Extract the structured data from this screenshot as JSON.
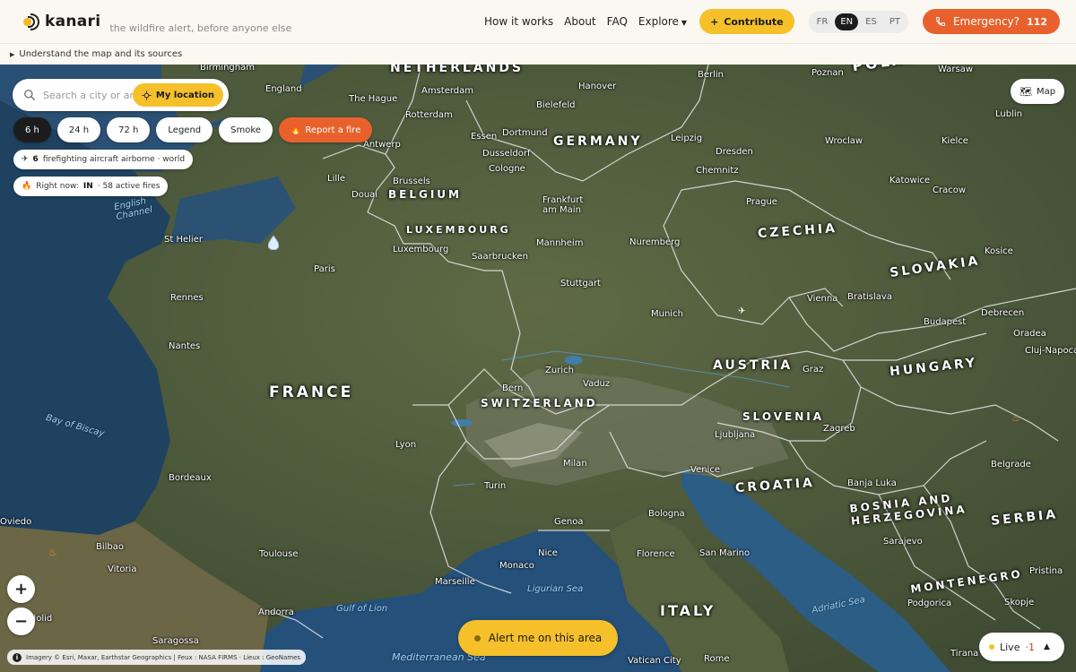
{
  "header": {
    "brand": "kanari",
    "tagline": "the wildfire alert, before anyone else",
    "nav": [
      "How it works",
      "About",
      "FAQ",
      "Explore"
    ],
    "contribute": "Contribute",
    "languages": [
      "FR",
      "EN",
      "ES",
      "PT"
    ],
    "active_language": "EN",
    "emergency_label": "Emergency?",
    "emergency_number": "112"
  },
  "subbar": {
    "label": "Understand the map and its sources"
  },
  "search": {
    "placeholder": "Search a city or area",
    "my_location": "My location"
  },
  "time_filters": [
    "6 h",
    "24 h",
    "72 h"
  ],
  "active_filter": "6 h",
  "buttons": {
    "legend": "Legend",
    "smoke": "Smoke",
    "report": "Report a fire",
    "map": "Map"
  },
  "aircraft": {
    "count": "6",
    "text": "firefighting aircraft airborne · world"
  },
  "right_now": {
    "label": "Right now:",
    "region": "IN",
    "fires": "· 58 active fires"
  },
  "zoom": {
    "in": "+",
    "out": "−"
  },
  "alert_button": "Alert me on this area",
  "attribution": "Imagery © Esri, Maxar, Earthstar Geographics | Feux : NASA FIRMS · Lieux : GeoNames",
  "live": {
    "label": "Live",
    "count": "·1"
  },
  "icons": [
    "search-icon",
    "crosshair-icon",
    "flame-icon",
    "plane-icon",
    "phone-icon",
    "plus-icon",
    "map-icon",
    "info-icon",
    "chevron-up-icon"
  ],
  "colors": {
    "accent": "#f5c02a",
    "emergency": "#e8612d",
    "dark": "#1c1c1c"
  },
  "map": {
    "countries": [
      {
        "id": "netherlands",
        "label": "NETHERLANDS"
      },
      {
        "id": "germany",
        "label": "GERMANY"
      },
      {
        "id": "belgium",
        "label": "BELGIUM"
      },
      {
        "id": "luxembourg",
        "label": "LUXEMBOURG"
      },
      {
        "id": "czechia",
        "label": "CZECHIA"
      },
      {
        "id": "slovakia",
        "label": "SLOVAKIA"
      },
      {
        "id": "austria",
        "label": "AUSTRIA"
      },
      {
        "id": "hungary",
        "label": "HUNGARY"
      },
      {
        "id": "france",
        "label": "FRANCE"
      },
      {
        "id": "switzerland",
        "label": "SWITZERLAND"
      },
      {
        "id": "slovenia",
        "label": "SLOVENIA"
      },
      {
        "id": "croatia",
        "label": "CROATIA"
      },
      {
        "id": "bosnia",
        "label": "BOSNIA AND\nHERZEGOVINA"
      },
      {
        "id": "serbia",
        "label": "SERBIA"
      },
      {
        "id": "montenegro",
        "label": "MONTENEGRO"
      },
      {
        "id": "italy",
        "label": "ITALY"
      },
      {
        "id": "poland",
        "label": "POLAND"
      }
    ],
    "cities": [
      "Birmingham",
      "England",
      "The Hague",
      "Amsterdam",
      "Rotterdam",
      "Antwerp",
      "Brussels",
      "Lille",
      "Douai",
      "Luxembourg",
      "Paris",
      "St Helier",
      "Rennes",
      "Nantes",
      "Bordeaux",
      "Toulouse",
      "Bilbao",
      "Vitoria",
      "Oviedo",
      "Valladolid",
      "Andorra",
      "Saragossa",
      "Hanover",
      "Bielefeld",
      "Essen",
      "Dortmund",
      "Dusseldorf",
      "Cologne",
      "Frankfurt am Main",
      "Saarbrucken",
      "Mannheim",
      "Stuttgart",
      "Nuremberg",
      "Leipzig",
      "Dresden",
      "Chemnitz",
      "Berlin",
      "Poznan",
      "Warsaw",
      "Wroclaw",
      "Lublin",
      "Kielce",
      "Katowice",
      "Cracow",
      "Prague",
      "Munich",
      "Vienna",
      "Bratislava",
      "Budapest",
      "Debrecen",
      "Oradea",
      "Cluj-Napoca",
      "Kosice",
      "Zurich",
      "Vaduz",
      "Bern",
      "Graz",
      "Ljubljana",
      "Zagreb",
      "Lyon",
      "Milan",
      "Turin",
      "Genoa",
      "Venice",
      "Bologna",
      "Florence",
      "San Marino",
      "Monaco",
      "Marseille",
      "Nice",
      "Banja Luka",
      "Sarajevo",
      "Belgrade",
      "Podgorica",
      "Skopje",
      "Pristina",
      "Vatican City",
      "Rome",
      "Tirana"
    ],
    "seas": [
      "English Channel",
      "Bay of Biscay",
      "Ligurian Sea",
      "Gulf of Lion",
      "Adriatic Sea",
      "Mediterranean Sea"
    ]
  }
}
